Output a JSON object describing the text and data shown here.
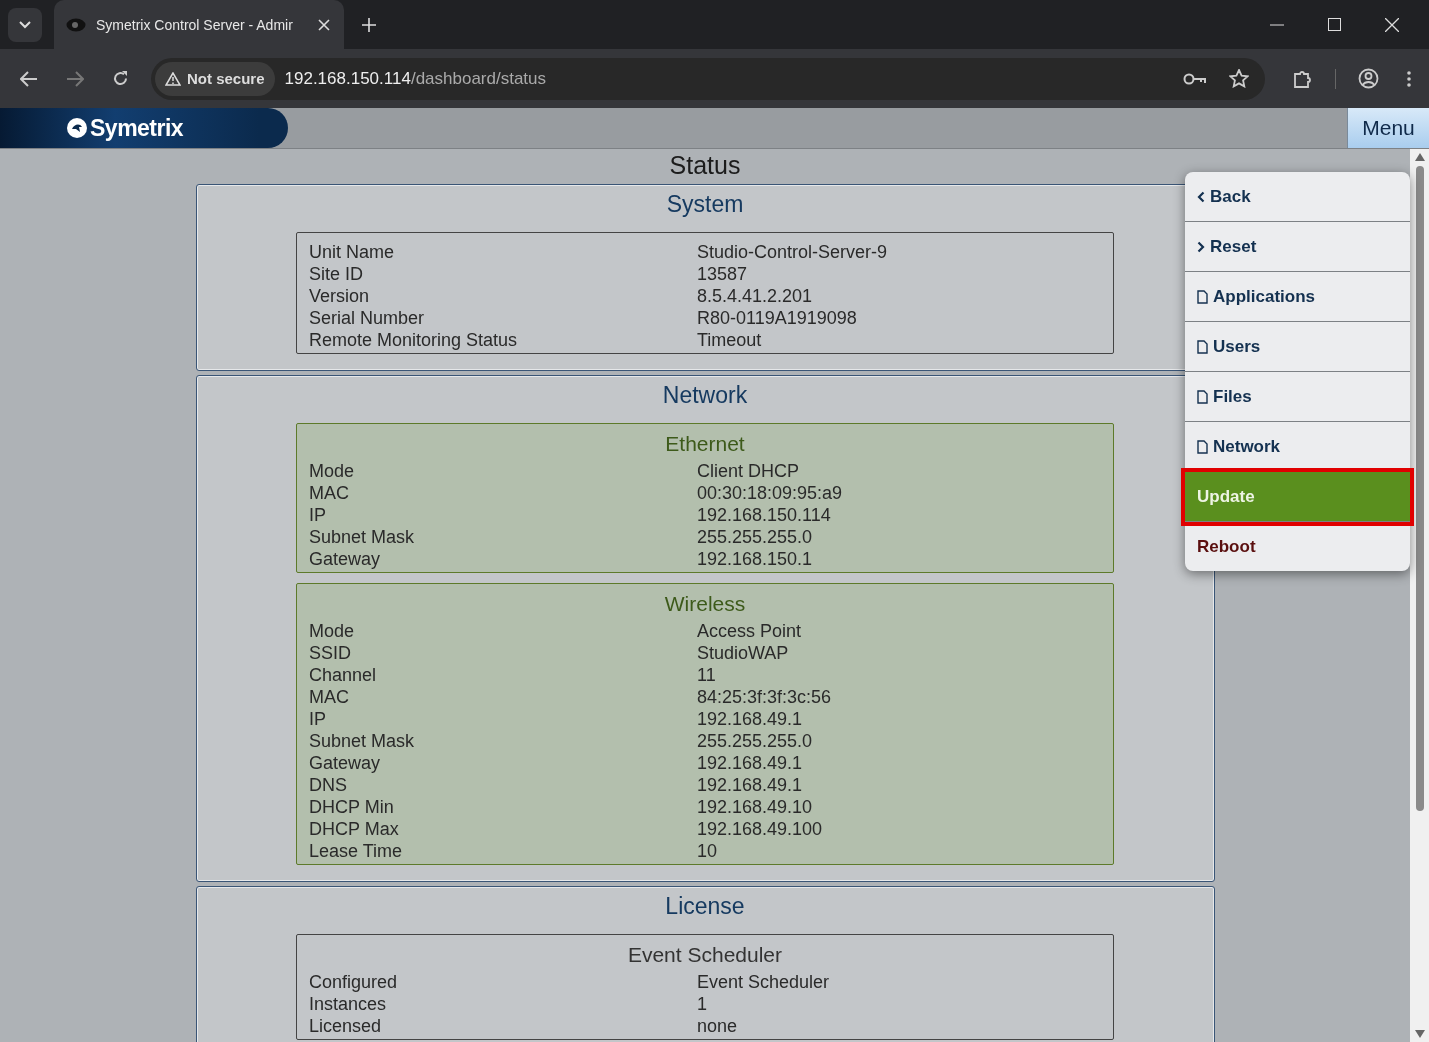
{
  "browser": {
    "tab_title": "Symetrix Control Server - Admir",
    "address_warning": "Not secure",
    "url_host": "192.168.150.114",
    "url_path": "/dashboard/status"
  },
  "header": {
    "logo": "Symetrix",
    "menu_button": "Menu"
  },
  "page_title": "Status",
  "sections": [
    {
      "title": "System",
      "groups": [
        {
          "kind": "plain",
          "rows": [
            [
              "Unit Name",
              "Studio-Control-Server-9"
            ],
            [
              "Site ID",
              "13587"
            ],
            [
              "Version",
              "8.5.4.41.2.201"
            ],
            [
              "Serial Number",
              "R80-0119A1919098"
            ],
            [
              "Remote Monitoring Status",
              "Timeout"
            ]
          ]
        }
      ]
    },
    {
      "title": "Network",
      "groups": [
        {
          "title": "Ethernet",
          "kind": "green",
          "rows": [
            [
              "Mode",
              "Client DHCP"
            ],
            [
              "MAC",
              "00:30:18:09:95:a9"
            ],
            [
              "IP",
              "192.168.150.114"
            ],
            [
              "Subnet Mask",
              "255.255.255.0"
            ],
            [
              "Gateway",
              "192.168.150.1"
            ]
          ]
        },
        {
          "title": "Wireless",
          "kind": "green",
          "rows": [
            [
              "Mode",
              "Access Point"
            ],
            [
              "SSID",
              "StudioWAP"
            ],
            [
              "Channel",
              "11"
            ],
            [
              "MAC",
              "84:25:3f:3f:3c:56"
            ],
            [
              "IP",
              "192.168.49.1"
            ],
            [
              "Subnet Mask",
              "255.255.255.0"
            ],
            [
              "Gateway",
              "192.168.49.1"
            ],
            [
              "DNS",
              "192.168.49.1"
            ],
            [
              "DHCP Min",
              "192.168.49.10"
            ],
            [
              "DHCP Max",
              "192.168.49.100"
            ],
            [
              "Lease Time",
              "10"
            ]
          ]
        }
      ]
    },
    {
      "title": "License",
      "groups": [
        {
          "title": "Event Scheduler",
          "kind": "plain",
          "rows": [
            [
              "Configured",
              "Event Scheduler"
            ],
            [
              "Instances",
              "1"
            ],
            [
              "Licensed",
              "none"
            ]
          ]
        }
      ]
    }
  ],
  "menu": [
    {
      "label": "Back",
      "kind": "back",
      "selected": false,
      "highlighted": false
    },
    {
      "label": "Reset",
      "kind": "forward",
      "selected": false,
      "highlighted": false
    },
    {
      "label": "Applications",
      "kind": "doc",
      "selected": false,
      "highlighted": false
    },
    {
      "label": "Users",
      "kind": "doc",
      "selected": false,
      "highlighted": false
    },
    {
      "label": "Files",
      "kind": "doc",
      "selected": false,
      "highlighted": false
    },
    {
      "label": "Network",
      "kind": "doc",
      "selected": false,
      "highlighted": false
    },
    {
      "label": "Update",
      "kind": "action",
      "selected": true,
      "highlighted": true
    },
    {
      "label": "Reboot",
      "kind": "danger",
      "selected": false,
      "highlighted": false
    }
  ]
}
